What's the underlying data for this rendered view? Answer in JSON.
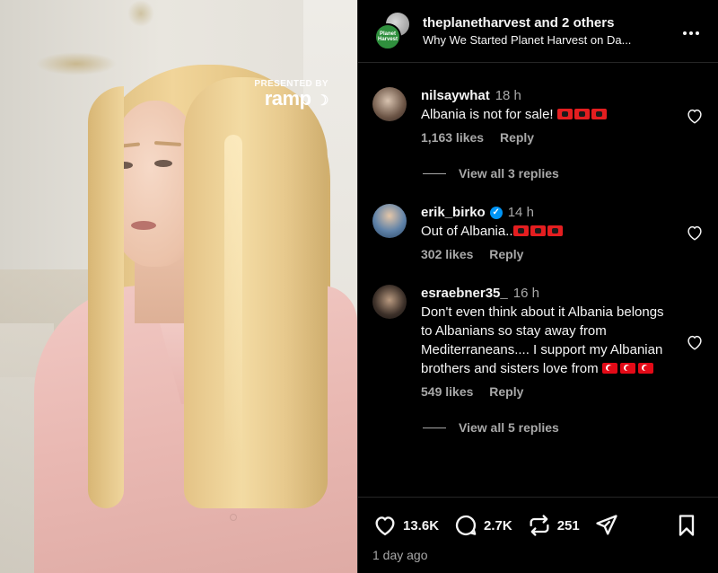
{
  "media": {
    "brand_small": "PRESENTED BY",
    "brand_name": "ramp"
  },
  "header": {
    "username": "theplanetharvest",
    "others": "and 2 others",
    "subtitle": "Why We Started Planet Harvest on Da...",
    "avatar_text": "Planet Harvest",
    "more_icon": "more-horizontal-icon"
  },
  "comments": [
    {
      "username": "nilsaywhat",
      "time": "18 h",
      "text": "Albania is not for sale!",
      "flags": "albania",
      "flag_count": 3,
      "likes": "1,163 likes",
      "reply": "Reply",
      "view_replies": "View all 3 replies",
      "verified": false
    },
    {
      "username": "erik_birko",
      "time": "14 h",
      "text": "Out of Albania..",
      "flags": "albania",
      "flag_count": 3,
      "likes": "302 likes",
      "reply": "Reply",
      "verified": true
    },
    {
      "username": "esraebner35_",
      "time": "16 h",
      "text": "Don't even think about it Albania belongs to Albanians so stay away from Mediterraneans.... I support my Albanian brothers and sisters love from",
      "flags": "turkey",
      "flag_count": 3,
      "likes": "549 likes",
      "reply": "Reply",
      "view_replies": "View all 5 replies",
      "verified": false
    }
  ],
  "footer": {
    "likes": "13.6K",
    "comments": "2.7K",
    "reposts": "251",
    "date": "1 day ago"
  },
  "colors": {
    "background": "#000000",
    "text": "#f5f5f5",
    "muted": "#a8a8a8",
    "verified": "#0095f6",
    "albania_flag": "#e41e20",
    "turkey_flag": "#e30a17"
  }
}
